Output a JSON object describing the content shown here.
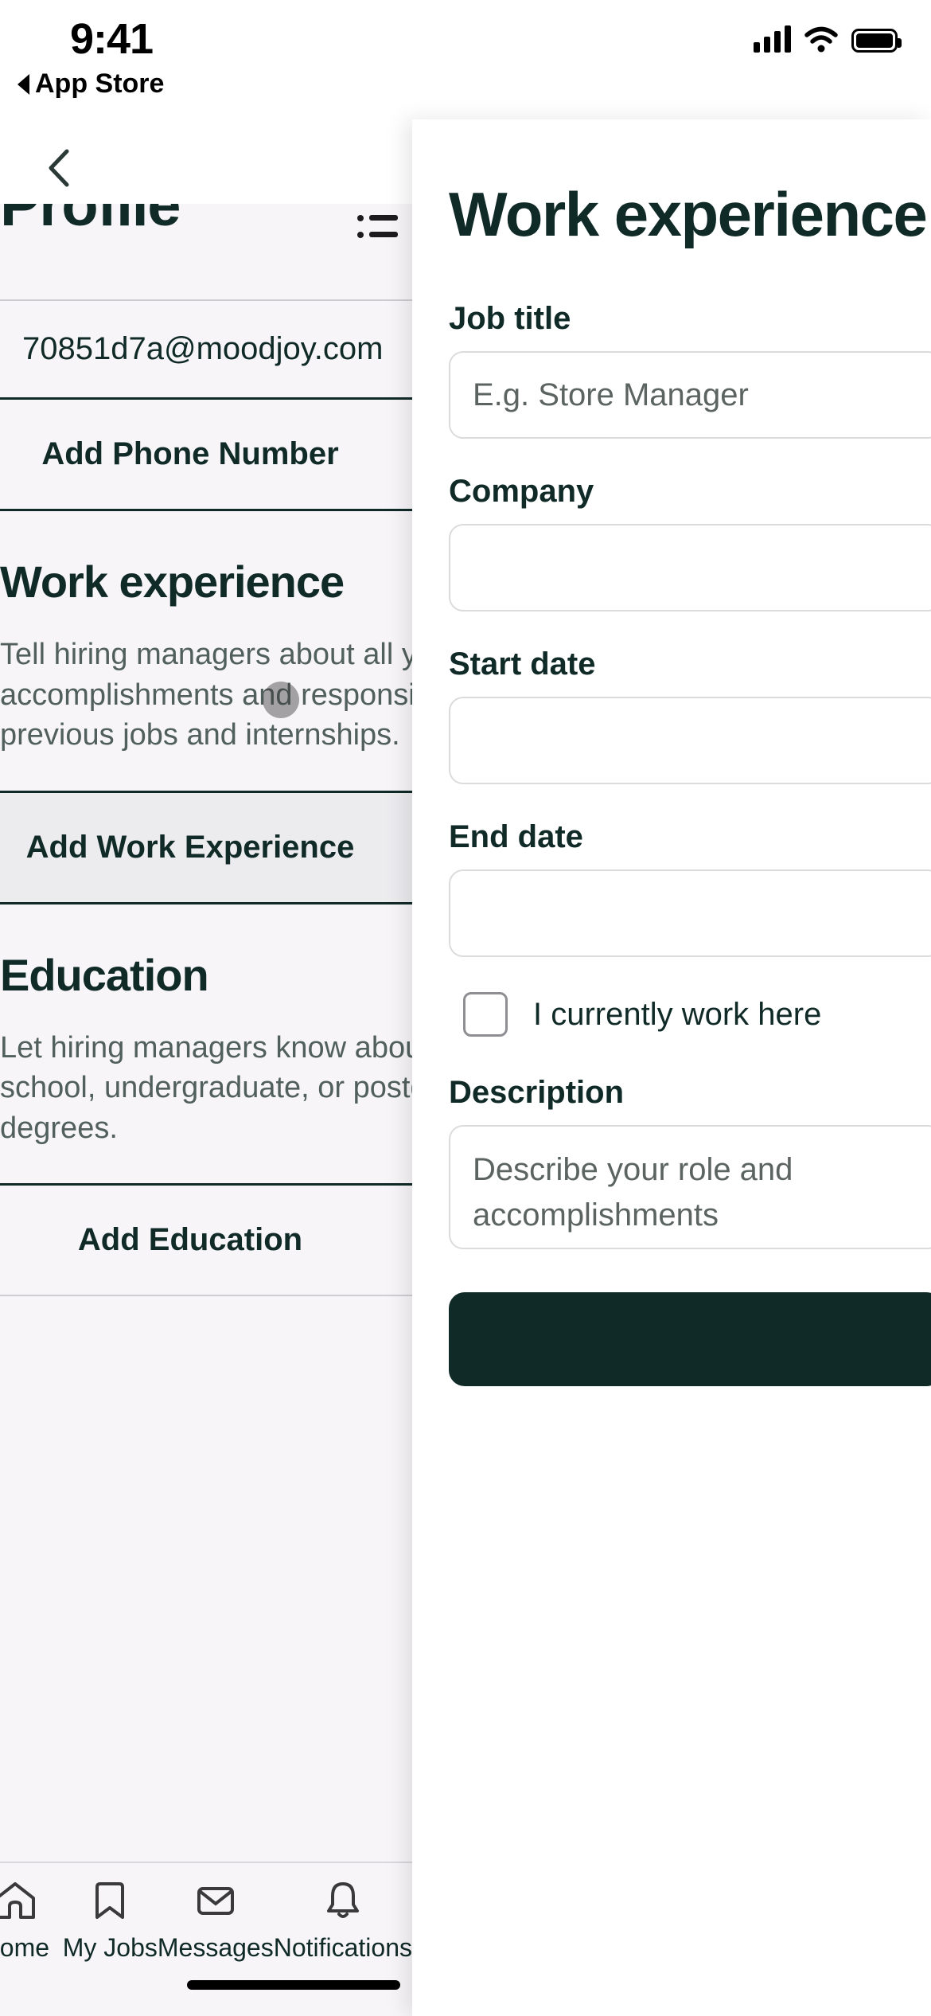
{
  "status_bar": {
    "time": "9:41",
    "back_app": "App Store",
    "signal_icon": "cellular-signal-icon",
    "wifi_icon": "wifi-icon",
    "battery_icon": "battery-icon"
  },
  "nav": {
    "back_icon": "chevron-left-icon"
  },
  "profile_screen": {
    "title": "Profile",
    "list_icon": "list-icon",
    "email_icon": "mail-icon",
    "email": "70851d7a@moodjoy.com",
    "add_phone_label": "Add Phone Number",
    "work": {
      "heading": "Work experience",
      "description_lines": [
        "Tell hiring managers about all your",
        "accomplishments and responsiblities at your",
        "previous jobs and internships."
      ],
      "button_label": "Add Work Experience"
    },
    "education": {
      "heading": "Education",
      "description_lines": [
        "Let hiring managers know about any high",
        "school, undergraduate, or postgraduate",
        "degrees."
      ],
      "button_label": "Add Education"
    }
  },
  "tabbar": {
    "items": [
      {
        "label": "Home",
        "icon": "home-icon"
      },
      {
        "label": "My Jobs",
        "icon": "bookmark-icon"
      },
      {
        "label": "Messages",
        "icon": "mail-icon"
      },
      {
        "label": "Notifications",
        "icon": "bell-icon"
      }
    ]
  },
  "work_modal": {
    "title": "Work experience",
    "fields": [
      {
        "label": "Job title",
        "placeholder": "E.g. Store Manager",
        "value": ""
      },
      {
        "label": "Company",
        "placeholder": "",
        "value": ""
      },
      {
        "label": "Start date",
        "placeholder": "",
        "value": ""
      },
      {
        "label": "End date",
        "placeholder": "",
        "value": ""
      }
    ],
    "job_title_label": "Job title",
    "job_title_placeholder": "E.g. Store Manager",
    "company_label": "Company",
    "company_value": "",
    "start_date_label": "Start date",
    "start_date_value": "",
    "end_date_label": "End date",
    "end_date_value": "",
    "current_checkbox_label": "I currently work here",
    "current_checkbox_checked": false,
    "description_label": "Description",
    "description_placeholder_line1": "Describe your role and",
    "description_placeholder_line2": "accomplishments",
    "submit_label": ""
  },
  "colors": {
    "brand_dark": "#102a27",
    "page_bg": "#f7f5f7",
    "panel_bg": "#ffffff",
    "muted_text": "#51605c",
    "border": "#dcdadd"
  }
}
